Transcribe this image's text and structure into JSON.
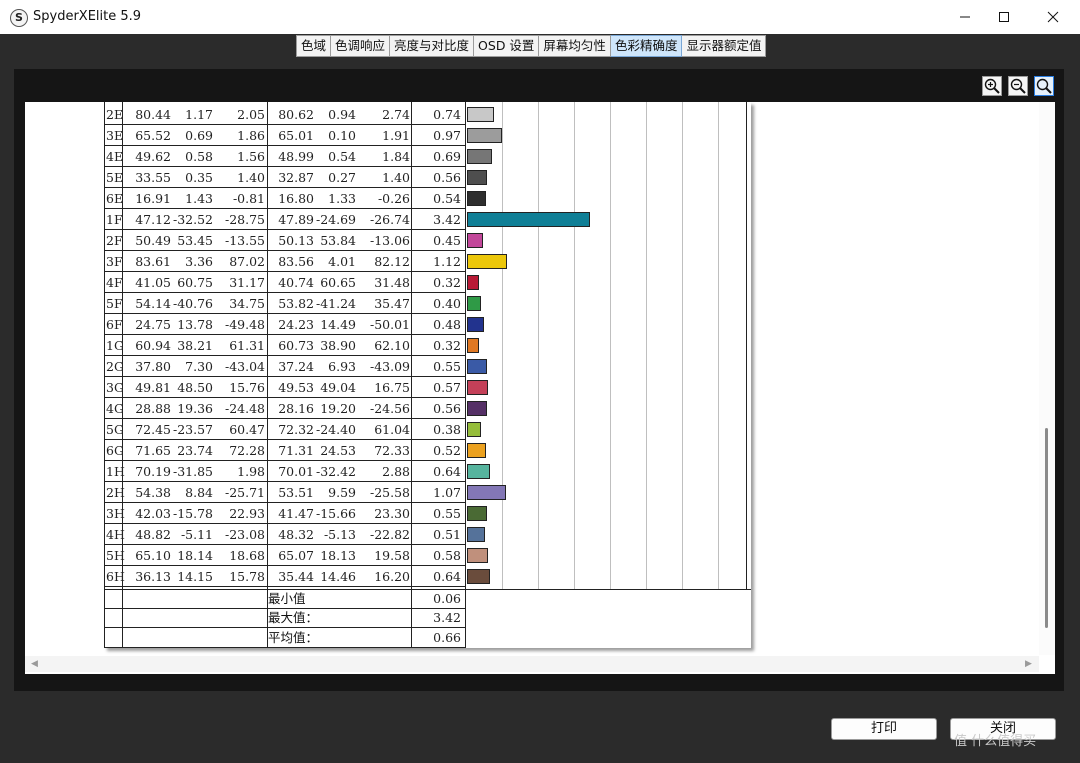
{
  "window": {
    "title": "SpyderXElite 5.9",
    "icon_letter": "S"
  },
  "tabs": [
    {
      "label": "色域",
      "active": false
    },
    {
      "label": "色调响应",
      "active": false
    },
    {
      "label": "亮度与对比度",
      "active": false
    },
    {
      "label": "OSD 设置",
      "active": false
    },
    {
      "label": "屏幕均匀性",
      "active": false
    },
    {
      "label": "色彩精确度",
      "active": true
    },
    {
      "label": "显示器额定值",
      "active": false
    }
  ],
  "zoom_tools": [
    "zoom-in-icon",
    "zoom-out-icon",
    "zoom-fit-icon"
  ],
  "table": {
    "rows": [
      {
        "id": "2E",
        "v": [
          "80.44",
          "1.17",
          "2.05",
          "80.62",
          "0.94",
          "2.74"
        ],
        "de": "0.74",
        "color": "#c8c8c8",
        "de_value": 0.74
      },
      {
        "id": "3E",
        "v": [
          "65.52",
          "0.69",
          "1.86",
          "65.01",
          "0.10",
          "1.91"
        ],
        "de": "0.97",
        "color": "#9c9c9c",
        "de_value": 0.97
      },
      {
        "id": "4E",
        "v": [
          "49.62",
          "0.58",
          "1.56",
          "48.99",
          "0.54",
          "1.84"
        ],
        "de": "0.69",
        "color": "#767676",
        "de_value": 0.69
      },
      {
        "id": "5E",
        "v": [
          "33.55",
          "0.35",
          "1.40",
          "32.87",
          "0.27",
          "1.40"
        ],
        "de": "0.56",
        "color": "#4e4e4e",
        "de_value": 0.56
      },
      {
        "id": "6E",
        "v": [
          "16.91",
          "1.43",
          "-0.81",
          "16.80",
          "1.33",
          "-0.26"
        ],
        "de": "0.54",
        "color": "#2e2e2e",
        "de_value": 0.54
      },
      {
        "id": "1F",
        "v": [
          "47.12",
          "-32.52",
          "-28.75",
          "47.89",
          "-24.69",
          "-26.74"
        ],
        "de": "3.42",
        "color": "#0f7f96",
        "de_value": 3.42
      },
      {
        "id": "2F",
        "v": [
          "50.49",
          "53.45",
          "-13.55",
          "50.13",
          "53.84",
          "-13.06"
        ],
        "de": "0.45",
        "color": "#c2479a",
        "de_value": 0.45
      },
      {
        "id": "3F",
        "v": [
          "83.61",
          "3.36",
          "87.02",
          "83.56",
          "4.01",
          "82.12"
        ],
        "de": "1.12",
        "color": "#ecc70a",
        "de_value": 1.12
      },
      {
        "id": "4F",
        "v": [
          "41.05",
          "60.75",
          "31.17",
          "40.74",
          "60.65",
          "31.48"
        ],
        "de": "0.32",
        "color": "#b81a36",
        "de_value": 0.32
      },
      {
        "id": "5F",
        "v": [
          "54.14",
          "-40.76",
          "34.75",
          "53.82",
          "-41.24",
          "35.47"
        ],
        "de": "0.40",
        "color": "#2f9a46",
        "de_value": 0.4
      },
      {
        "id": "6F",
        "v": [
          "24.75",
          "13.78",
          "-49.48",
          "24.23",
          "14.49",
          "-50.01"
        ],
        "de": "0.48",
        "color": "#22338e",
        "de_value": 0.48
      },
      {
        "id": "1G",
        "v": [
          "60.94",
          "38.21",
          "61.31",
          "60.73",
          "38.90",
          "62.10"
        ],
        "de": "0.32",
        "color": "#e07822",
        "de_value": 0.32
      },
      {
        "id": "2G",
        "v": [
          "37.80",
          "7.30",
          "-43.04",
          "37.24",
          "6.93",
          "-43.09"
        ],
        "de": "0.55",
        "color": "#3a5aa6",
        "de_value": 0.55
      },
      {
        "id": "3G",
        "v": [
          "49.81",
          "48.50",
          "15.76",
          "49.53",
          "49.04",
          "16.75"
        ],
        "de": "0.57",
        "color": "#c44058",
        "de_value": 0.57
      },
      {
        "id": "4G",
        "v": [
          "28.88",
          "19.36",
          "-24.48",
          "28.16",
          "19.20",
          "-24.56"
        ],
        "de": "0.56",
        "color": "#553066",
        "de_value": 0.56
      },
      {
        "id": "5G",
        "v": [
          "72.45",
          "-23.57",
          "60.47",
          "72.32",
          "-24.40",
          "61.04"
        ],
        "de": "0.38",
        "color": "#95bd3a",
        "de_value": 0.38
      },
      {
        "id": "6G",
        "v": [
          "71.65",
          "23.74",
          "72.28",
          "71.31",
          "24.53",
          "72.33"
        ],
        "de": "0.52",
        "color": "#eba11f",
        "de_value": 0.52
      },
      {
        "id": "1H",
        "v": [
          "70.19",
          "-31.85",
          "1.98",
          "70.01",
          "-32.42",
          "2.88"
        ],
        "de": "0.64",
        "color": "#56b49e",
        "de_value": 0.64
      },
      {
        "id": "2H",
        "v": [
          "54.38",
          "8.84",
          "-25.71",
          "53.51",
          "9.59",
          "-25.58"
        ],
        "de": "1.07",
        "color": "#8377b6",
        "de_value": 1.07
      },
      {
        "id": "3H",
        "v": [
          "42.03",
          "-15.78",
          "22.93",
          "41.47",
          "-15.66",
          "23.30"
        ],
        "de": "0.55",
        "color": "#4a6a34",
        "de_value": 0.55
      },
      {
        "id": "4H",
        "v": [
          "48.82",
          "-5.11",
          "-23.08",
          "48.32",
          "-5.13",
          "-22.82"
        ],
        "de": "0.51",
        "color": "#55729a",
        "de_value": 0.51
      },
      {
        "id": "5H",
        "v": [
          "65.10",
          "18.14",
          "18.68",
          "65.07",
          "18.13",
          "19.58"
        ],
        "de": "0.58",
        "color": "#c0907c",
        "de_value": 0.58
      },
      {
        "id": "6H",
        "v": [
          "36.13",
          "14.15",
          "15.78",
          "35.44",
          "14.46",
          "16.20"
        ],
        "de": "0.64",
        "color": "#6a4c3c",
        "de_value": 0.64
      }
    ],
    "stats": [
      {
        "label": "最小值",
        "value": "0.06"
      },
      {
        "label": "最大值：",
        "value": "3.42"
      },
      {
        "label": "平均值：",
        "value": "0.66"
      }
    ]
  },
  "buttons": {
    "print": "打印",
    "close": "关闭"
  },
  "watermark": "值 什么值得买"
}
